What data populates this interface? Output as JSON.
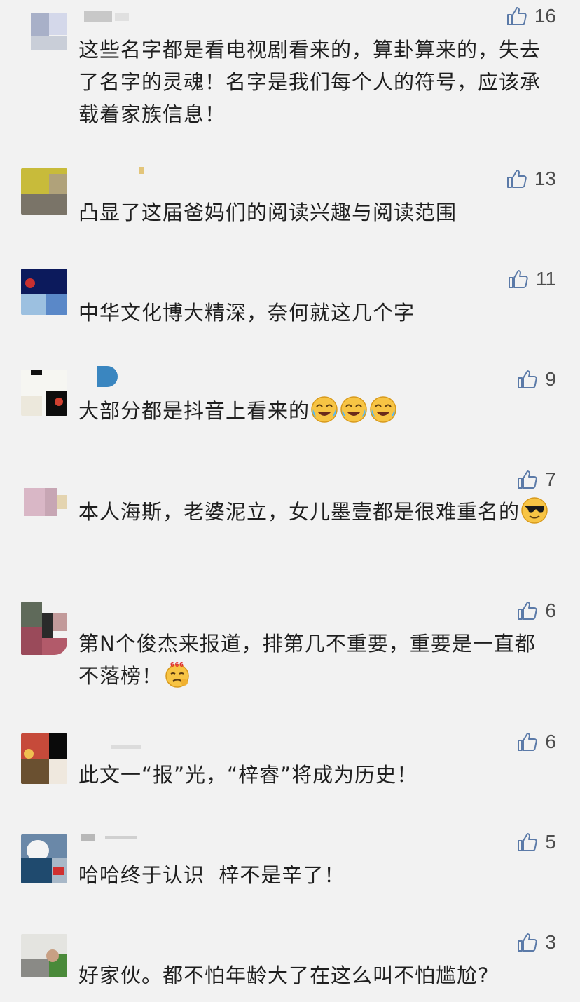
{
  "colors": {
    "background": "#f2f2f2",
    "text": "#1f1f1f",
    "like_icon": "#5b7aa8",
    "like_count": "#4d4d4d"
  },
  "like_icon": "thumbs-up-outline-icon",
  "comments": [
    {
      "likes": "16",
      "text": "这些名字都是看电视剧看来的，算卦算来的，失去了名字的灵魂！名字是我们每个人的符号，应该承载着家族信息！",
      "emojis": []
    },
    {
      "likes": "13",
      "text": "凸显了这届爸妈们的阅读兴趣与阅读范围",
      "emojis": []
    },
    {
      "likes": "11",
      "text": "中华文化博大精深，奈何就这几个字",
      "emojis": []
    },
    {
      "likes": "9",
      "text": "大部分都是抖音上看来的",
      "emojis": [
        "laughing-crying-emoji",
        "laughing-crying-emoji",
        "laughing-crying-emoji"
      ]
    },
    {
      "likes": "7",
      "text": "本人海斯，老婆泥立，女儿墨壹都是很难重名的",
      "emojis": [
        "sunglasses-emoji"
      ]
    },
    {
      "likes": "6",
      "text": "第N个俊杰来报道，排第几不重要，重要是一直都不落榜！",
      "emojis": [
        "666-emoji"
      ],
      "emoji_text": "666"
    },
    {
      "likes": "6",
      "text": "此文一“报”光，“梓睿”将成为历史！",
      "emojis": []
    },
    {
      "likes": "5",
      "text": "哈哈终于认识  梓不是辛了！",
      "emojis": []
    },
    {
      "likes": "3",
      "text": "好家伙。都不怕年龄大了在这么叫不怕尴尬?",
      "emojis": []
    }
  ]
}
